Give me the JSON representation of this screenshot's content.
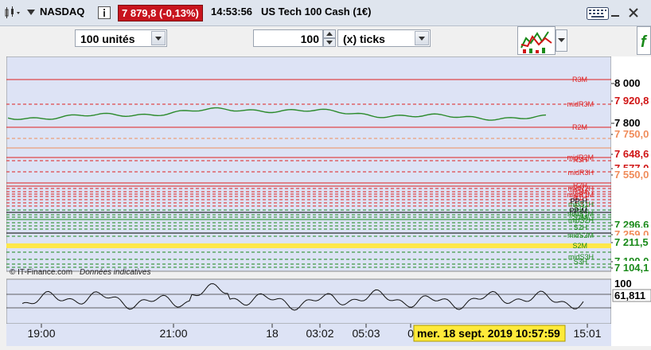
{
  "header": {
    "instrument": "NASDAQ",
    "price_badge": "7 879,8 (-0,13%)",
    "time": "14:53:56",
    "title": "US Tech 100 Cash (1€)"
  },
  "toolbar": {
    "quantity_select": "100 unités",
    "ticks_value": "100",
    "ticks_unit": "(x) ticks"
  },
  "chart": {
    "watermark": "© IT-Finance.com",
    "watermark_note": "Données indicatives",
    "cursor_date": "mer. 18 sept. 2019 10:57:59",
    "x_ticks": [
      "19:00",
      "21:00",
      "18",
      "03:02",
      "05:03",
      "0",
      "15:01"
    ],
    "main_axis": [
      {
        "label": "8 000",
        "color": "#000000",
        "bold": true
      },
      {
        "label": "7 920,8",
        "color": "#d01414",
        "bold": true
      },
      {
        "label": "7 800",
        "color": "#000000",
        "bold": true
      },
      {
        "label": "7 750,0",
        "color": "#f08c5a",
        "bold": true
      },
      {
        "label": "7 648,6",
        "color": "#d01414",
        "bold": true
      },
      {
        "label": "7 577,0",
        "color": "#d01414",
        "bold": true
      },
      {
        "label": "7 550,0",
        "color": "#f08c5a",
        "bold": true
      },
      {
        "label": "7 296,6",
        "color": "#1a8a1a",
        "bold": true
      },
      {
        "label": "7 259,0",
        "color": "#f08c5a",
        "bold": true
      },
      {
        "label": "7 211,5",
        "color": "#1a8a1a",
        "bold": true
      },
      {
        "label": "7 190,0",
        "color": "#1a8a1a",
        "bold": true
      },
      {
        "label": "7 104,1",
        "color": "#1a8a1a",
        "bold": true
      }
    ],
    "level_labels": [
      "R3M",
      "midR3M",
      "R2M",
      "midR2M",
      "R3H",
      "midR3H",
      "R2H",
      "midR2H",
      "R1M",
      "midR1M",
      "R1H",
      "PP-H",
      "midS1H",
      "S1H",
      "PP-M",
      "midS1M",
      "S1M",
      "midS2H",
      "S2H",
      "midS2M",
      "S2M",
      "midS3H",
      "S3H"
    ],
    "osc_axis": [
      "100",
      "61,811"
    ],
    "colors": {
      "resistance": "#e02020",
      "support": "#1a8a1a",
      "pivot": "#000000",
      "highlight": "#ffe84a",
      "plot_bg": "#dde3f5",
      "price_line": "#2a8a2a"
    }
  }
}
